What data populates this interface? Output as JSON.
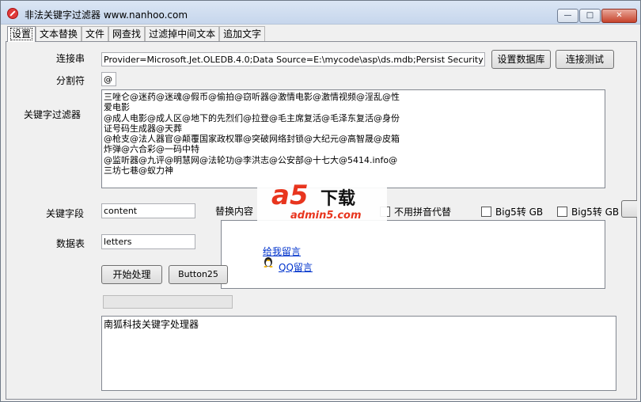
{
  "window": {
    "title": "非法关键字过滤器 www.nanhoo.com",
    "controls": {
      "minimize": "—",
      "maximize": "□",
      "close": "✕"
    }
  },
  "tabs": [
    {
      "label": "设置",
      "active": true
    },
    {
      "label": "文本替换"
    },
    {
      "label": "文件"
    },
    {
      "label": "网查找"
    },
    {
      "label": "过滤掉中间文本"
    },
    {
      "label": "追加文字"
    }
  ],
  "settings": {
    "connection_label": "连接串",
    "connection_value": "Provider=Microsoft.Jet.OLEDB.4.0;Data Source=E:\\mycode\\asp\\ds.mdb;Persist Security Info=False",
    "set_db_button": "设置数据库",
    "test_conn_button": "连接测试",
    "separator_label": "分割符",
    "separator_value": "@",
    "keyword_filter_label": "关键字过滤器",
    "keyword_lines": [
      "三唑仑@迷药@迷魂@假币@偷拍@窃听器@激情电影@激情视频@淫乱@性",
      "爱电影",
      "@成人电影@成人区@地下的先烈们@拉登@毛主席复活@毛泽东复活@身份",
      "证号码生成器@天葬",
      "@枪支@法人器官@颠覆国家政权罪@突破网络封锁@大纪元@高智晟@皮箱",
      "炸弹@六合彩@一码中特",
      "@监听器@九评@明慧网@法轮功@李洪志@公安部@十七大@5414.info@",
      "三坊七巷@蚁力神"
    ],
    "keyword_field_label": "关键字段",
    "keyword_field_value": "content",
    "replace_content_label": "替换内容",
    "no_pinyin_label": "不用拼音代替",
    "big5_gb_1_label": "Big5转 GB",
    "big5_gb_2_label": "Big5转 GB",
    "data_table_label": "数据表",
    "data_table_value": "letters",
    "start_button": "开始处理",
    "button25": "Button25",
    "leave_message_link": "给我留言",
    "qq_message_link": "QQ留言",
    "progress_fraction": 0,
    "output_text": "南狐科技关键字处理器"
  },
  "watermark": {
    "logo": "a5",
    "xz": "下载",
    "site": "admin5.com"
  },
  "icons": {
    "app": "no-entry-icon",
    "qq": "penguin-icon"
  }
}
